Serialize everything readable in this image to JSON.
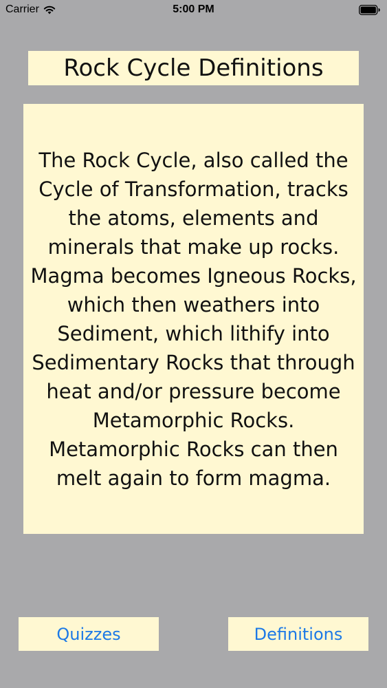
{
  "status_bar": {
    "carrier": "Carrier",
    "time": "5:00 PM",
    "icons": [
      "wifi-icon",
      "battery-icon"
    ]
  },
  "title": "Rock Cycle Definitions",
  "definition": "The Rock Cycle, also called the Cycle of Transformation, tracks the atoms, elements and minerals that make up rocks. Magma becomes Igneous Rocks, which then weathers into Sediment, which lithify into Sedimentary Rocks that through heat and/or pressure become Metamorphic Rocks. Metamorphic Rocks can then melt again to form magma.",
  "buttons": {
    "quizzes": "Quizzes",
    "definitions": "Definitions"
  },
  "colors": {
    "background": "#a9a9ab",
    "card": "#fff8d2",
    "button_text": "#1c79e6"
  }
}
